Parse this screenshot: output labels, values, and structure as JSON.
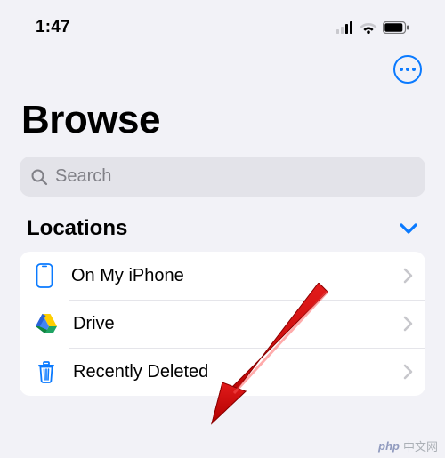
{
  "status": {
    "time": "1:47"
  },
  "accent": "#0a7aff",
  "page_title": "Browse",
  "search": {
    "placeholder": "Search"
  },
  "section": {
    "locations": {
      "title": "Locations",
      "items": [
        {
          "label": "On My iPhone",
          "icon": "iphone-icon"
        },
        {
          "label": "Drive",
          "icon": "drive-icon"
        },
        {
          "label": "Recently Deleted",
          "icon": "trash-icon"
        }
      ]
    }
  },
  "watermark": {
    "php": "php",
    "text": "中文网"
  }
}
